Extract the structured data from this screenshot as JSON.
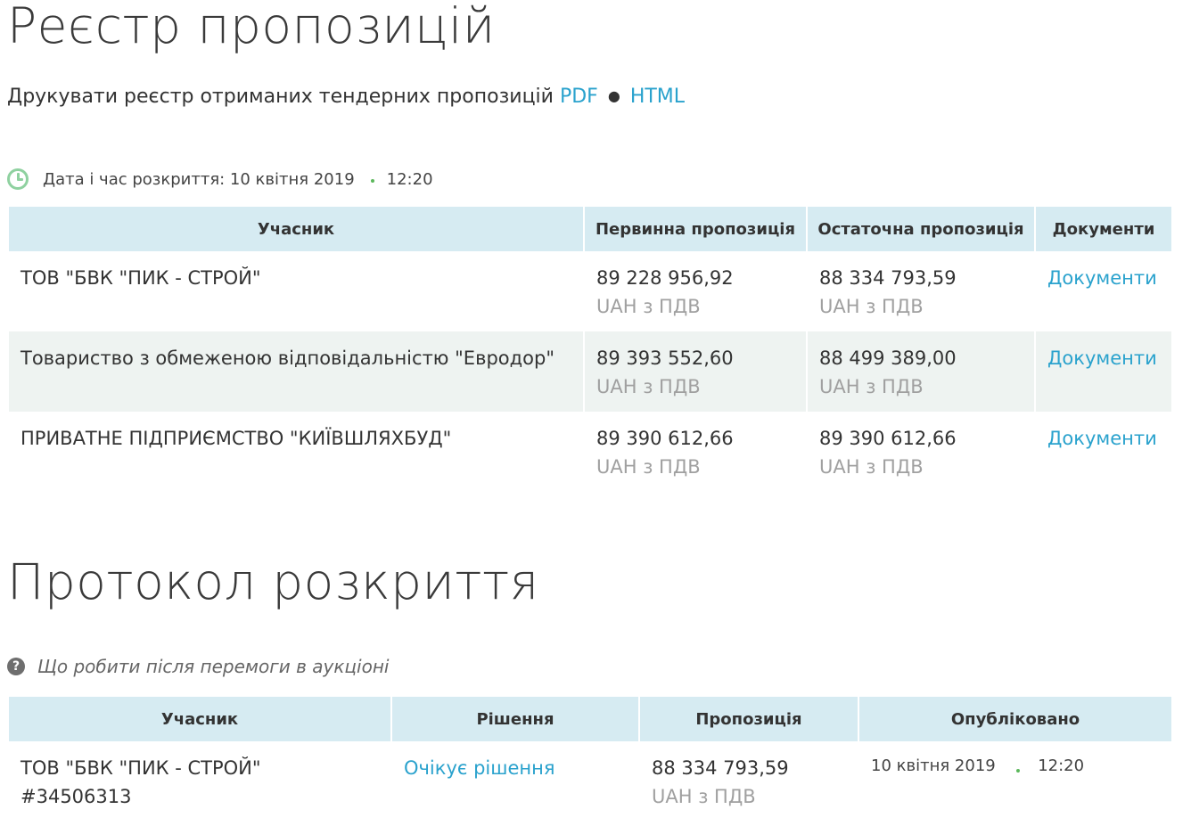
{
  "registry": {
    "title": "Реєстр пропозицій",
    "print_label": "Друкувати реєстр отриманих тендерних пропозицій",
    "print_pdf": "PDF",
    "print_separator": "●",
    "print_html": "HTML",
    "open_date_label": "Дата і час розкриття: 10 квітня 2019",
    "open_time": "12:20",
    "columns": [
      "Учасник",
      "Первинна пропозиція",
      "Остаточна пропозиція",
      "Документи"
    ],
    "rows": [
      {
        "participant": "ТОВ \"БВК \"ПИК - СТРОЙ\"",
        "initial": "89 228 956,92",
        "initial_currency": "UAH з ПДВ",
        "final": "88 334 793,59",
        "final_currency": "UAH з ПДВ",
        "docs": "Документи"
      },
      {
        "participant": "Товариство з обмеженою відповідальністю \"Евродор\"",
        "initial": "89 393 552,60",
        "initial_currency": "UAH з ПДВ",
        "final": "88 499 389,00",
        "final_currency": "UAH з ПДВ",
        "docs": "Документи"
      },
      {
        "participant": "ПРИВАТНЕ ПІДПРИЄМСТВО \"КИЇВШЛЯХБУД\"",
        "initial": "89 390 612,66",
        "initial_currency": "UAH з ПДВ",
        "final": "89 390 612,66",
        "final_currency": "UAH з ПДВ",
        "docs": "Документи"
      }
    ]
  },
  "protocol": {
    "title": "Протокол розкриття",
    "help_icon_text": "?",
    "help_text": "Що робити після перемоги в аукціоні",
    "columns": [
      "Учасник",
      "Рішення",
      "Пропозиція",
      "Опубліковано"
    ],
    "rows": [
      {
        "participant": "ТОВ \"БВК \"ПИК - СТРОЙ\"",
        "participant_id": "#34506313",
        "decision": "Очікує рішення",
        "offer": "88 334 793,59",
        "offer_currency": "UAH з ПДВ",
        "published_date": "10 квітня 2019",
        "published_time": "12:20"
      }
    ]
  },
  "colors": {
    "link": "#2aa2cd",
    "header_bg": "#d6ebf2",
    "row_alt_bg": "#eef3f1",
    "clock": "#8fd1a0",
    "dot": "#5cb85c"
  }
}
